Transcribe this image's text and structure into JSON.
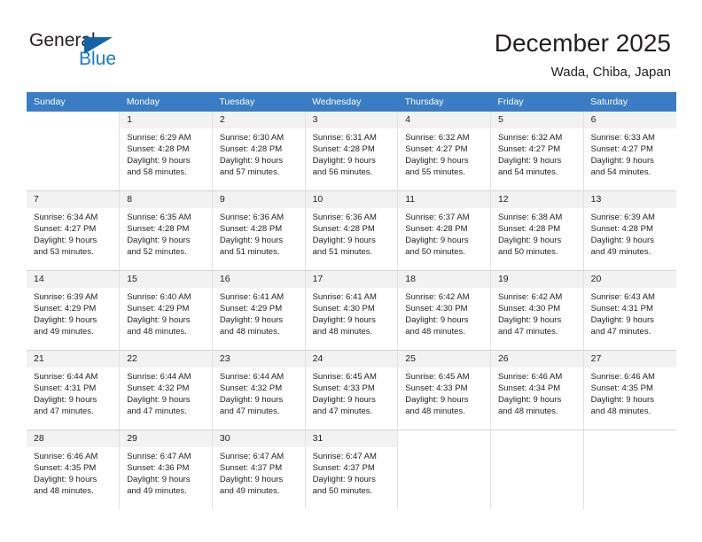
{
  "brand": {
    "name_top": "General",
    "name_bottom": "Blue",
    "triangle_color": "#1262a8",
    "blue_color": "#1a7bc4"
  },
  "header": {
    "title": "December 2025",
    "subtitle": "Wada, Chiba, Japan"
  },
  "theme": {
    "header_row_bg": "#3b7dc4",
    "header_row_text": "#ffffff",
    "daynum_bg": "#f2f2f2",
    "cell_border": "#e2e2e2"
  },
  "weekday_headers": [
    "Sunday",
    "Monday",
    "Tuesday",
    "Wednesday",
    "Thursday",
    "Friday",
    "Saturday"
  ],
  "weeks": [
    [
      {
        "day": "",
        "sunrise": "",
        "sunset": "",
        "daylight_line1": "",
        "daylight_line2": ""
      },
      {
        "day": "1",
        "sunrise": "Sunrise: 6:29 AM",
        "sunset": "Sunset: 4:28 PM",
        "daylight_line1": "Daylight: 9 hours",
        "daylight_line2": "and 58 minutes."
      },
      {
        "day": "2",
        "sunrise": "Sunrise: 6:30 AM",
        "sunset": "Sunset: 4:28 PM",
        "daylight_line1": "Daylight: 9 hours",
        "daylight_line2": "and 57 minutes."
      },
      {
        "day": "3",
        "sunrise": "Sunrise: 6:31 AM",
        "sunset": "Sunset: 4:28 PM",
        "daylight_line1": "Daylight: 9 hours",
        "daylight_line2": "and 56 minutes."
      },
      {
        "day": "4",
        "sunrise": "Sunrise: 6:32 AM",
        "sunset": "Sunset: 4:27 PM",
        "daylight_line1": "Daylight: 9 hours",
        "daylight_line2": "and 55 minutes."
      },
      {
        "day": "5",
        "sunrise": "Sunrise: 6:32 AM",
        "sunset": "Sunset: 4:27 PM",
        "daylight_line1": "Daylight: 9 hours",
        "daylight_line2": "and 54 minutes."
      },
      {
        "day": "6",
        "sunrise": "Sunrise: 6:33 AM",
        "sunset": "Sunset: 4:27 PM",
        "daylight_line1": "Daylight: 9 hours",
        "daylight_line2": "and 54 minutes."
      }
    ],
    [
      {
        "day": "7",
        "sunrise": "Sunrise: 6:34 AM",
        "sunset": "Sunset: 4:27 PM",
        "daylight_line1": "Daylight: 9 hours",
        "daylight_line2": "and 53 minutes."
      },
      {
        "day": "8",
        "sunrise": "Sunrise: 6:35 AM",
        "sunset": "Sunset: 4:28 PM",
        "daylight_line1": "Daylight: 9 hours",
        "daylight_line2": "and 52 minutes."
      },
      {
        "day": "9",
        "sunrise": "Sunrise: 6:36 AM",
        "sunset": "Sunset: 4:28 PM",
        "daylight_line1": "Daylight: 9 hours",
        "daylight_line2": "and 51 minutes."
      },
      {
        "day": "10",
        "sunrise": "Sunrise: 6:36 AM",
        "sunset": "Sunset: 4:28 PM",
        "daylight_line1": "Daylight: 9 hours",
        "daylight_line2": "and 51 minutes."
      },
      {
        "day": "11",
        "sunrise": "Sunrise: 6:37 AM",
        "sunset": "Sunset: 4:28 PM",
        "daylight_line1": "Daylight: 9 hours",
        "daylight_line2": "and 50 minutes."
      },
      {
        "day": "12",
        "sunrise": "Sunrise: 6:38 AM",
        "sunset": "Sunset: 4:28 PM",
        "daylight_line1": "Daylight: 9 hours",
        "daylight_line2": "and 50 minutes."
      },
      {
        "day": "13",
        "sunrise": "Sunrise: 6:39 AM",
        "sunset": "Sunset: 4:28 PM",
        "daylight_line1": "Daylight: 9 hours",
        "daylight_line2": "and 49 minutes."
      }
    ],
    [
      {
        "day": "14",
        "sunrise": "Sunrise: 6:39 AM",
        "sunset": "Sunset: 4:29 PM",
        "daylight_line1": "Daylight: 9 hours",
        "daylight_line2": "and 49 minutes."
      },
      {
        "day": "15",
        "sunrise": "Sunrise: 6:40 AM",
        "sunset": "Sunset: 4:29 PM",
        "daylight_line1": "Daylight: 9 hours",
        "daylight_line2": "and 48 minutes."
      },
      {
        "day": "16",
        "sunrise": "Sunrise: 6:41 AM",
        "sunset": "Sunset: 4:29 PM",
        "daylight_line1": "Daylight: 9 hours",
        "daylight_line2": "and 48 minutes."
      },
      {
        "day": "17",
        "sunrise": "Sunrise: 6:41 AM",
        "sunset": "Sunset: 4:30 PM",
        "daylight_line1": "Daylight: 9 hours",
        "daylight_line2": "and 48 minutes."
      },
      {
        "day": "18",
        "sunrise": "Sunrise: 6:42 AM",
        "sunset": "Sunset: 4:30 PM",
        "daylight_line1": "Daylight: 9 hours",
        "daylight_line2": "and 48 minutes."
      },
      {
        "day": "19",
        "sunrise": "Sunrise: 6:42 AM",
        "sunset": "Sunset: 4:30 PM",
        "daylight_line1": "Daylight: 9 hours",
        "daylight_line2": "and 47 minutes."
      },
      {
        "day": "20",
        "sunrise": "Sunrise: 6:43 AM",
        "sunset": "Sunset: 4:31 PM",
        "daylight_line1": "Daylight: 9 hours",
        "daylight_line2": "and 47 minutes."
      }
    ],
    [
      {
        "day": "21",
        "sunrise": "Sunrise: 6:44 AM",
        "sunset": "Sunset: 4:31 PM",
        "daylight_line1": "Daylight: 9 hours",
        "daylight_line2": "and 47 minutes."
      },
      {
        "day": "22",
        "sunrise": "Sunrise: 6:44 AM",
        "sunset": "Sunset: 4:32 PM",
        "daylight_line1": "Daylight: 9 hours",
        "daylight_line2": "and 47 minutes."
      },
      {
        "day": "23",
        "sunrise": "Sunrise: 6:44 AM",
        "sunset": "Sunset: 4:32 PM",
        "daylight_line1": "Daylight: 9 hours",
        "daylight_line2": "and 47 minutes."
      },
      {
        "day": "24",
        "sunrise": "Sunrise: 6:45 AM",
        "sunset": "Sunset: 4:33 PM",
        "daylight_line1": "Daylight: 9 hours",
        "daylight_line2": "and 47 minutes."
      },
      {
        "day": "25",
        "sunrise": "Sunrise: 6:45 AM",
        "sunset": "Sunset: 4:33 PM",
        "daylight_line1": "Daylight: 9 hours",
        "daylight_line2": "and 48 minutes."
      },
      {
        "day": "26",
        "sunrise": "Sunrise: 6:46 AM",
        "sunset": "Sunset: 4:34 PM",
        "daylight_line1": "Daylight: 9 hours",
        "daylight_line2": "and 48 minutes."
      },
      {
        "day": "27",
        "sunrise": "Sunrise: 6:46 AM",
        "sunset": "Sunset: 4:35 PM",
        "daylight_line1": "Daylight: 9 hours",
        "daylight_line2": "and 48 minutes."
      }
    ],
    [
      {
        "day": "28",
        "sunrise": "Sunrise: 6:46 AM",
        "sunset": "Sunset: 4:35 PM",
        "daylight_line1": "Daylight: 9 hours",
        "daylight_line2": "and 48 minutes."
      },
      {
        "day": "29",
        "sunrise": "Sunrise: 6:47 AM",
        "sunset": "Sunset: 4:36 PM",
        "daylight_line1": "Daylight: 9 hours",
        "daylight_line2": "and 49 minutes."
      },
      {
        "day": "30",
        "sunrise": "Sunrise: 6:47 AM",
        "sunset": "Sunset: 4:37 PM",
        "daylight_line1": "Daylight: 9 hours",
        "daylight_line2": "and 49 minutes."
      },
      {
        "day": "31",
        "sunrise": "Sunrise: 6:47 AM",
        "sunset": "Sunset: 4:37 PM",
        "daylight_line1": "Daylight: 9 hours",
        "daylight_line2": "and 50 minutes."
      },
      {
        "day": "",
        "sunrise": "",
        "sunset": "",
        "daylight_line1": "",
        "daylight_line2": ""
      },
      {
        "day": "",
        "sunrise": "",
        "sunset": "",
        "daylight_line1": "",
        "daylight_line2": ""
      },
      {
        "day": "",
        "sunrise": "",
        "sunset": "",
        "daylight_line1": "",
        "daylight_line2": ""
      }
    ]
  ]
}
